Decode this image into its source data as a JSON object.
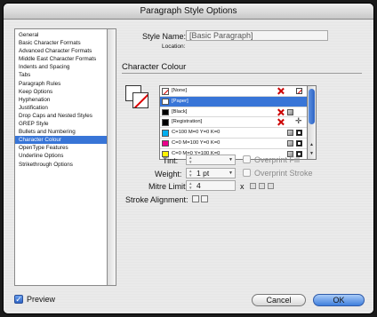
{
  "window": {
    "title": "Paragraph Style Options"
  },
  "categories": [
    "General",
    "Basic Character Formats",
    "Advanced Character Formats",
    "Middle East Character Formats",
    "Indents and Spacing",
    "Tabs",
    "Paragraph Rules",
    "Keep Options",
    "Hyphenation",
    "Justification",
    "Drop Caps and Nested Styles",
    "GREP Style",
    "Bullets and Numbering",
    "Character Colour",
    "OpenType Features",
    "Underline Options",
    "Strikethrough Options"
  ],
  "selected_category": "Character Colour",
  "style_name": {
    "label": "Style Name:",
    "value": "[Basic Paragraph]"
  },
  "location": {
    "label": "Location:"
  },
  "section_title": "Character Colour",
  "swatches": [
    {
      "name": "[None]",
      "color": "#ffffff",
      "kind": "none"
    },
    {
      "name": "[Paper]",
      "color": "#ffffff",
      "kind": "paper"
    },
    {
      "name": "[Black]",
      "color": "#000000",
      "kind": "black"
    },
    {
      "name": "[Registration]",
      "color": "#000000",
      "kind": "registration"
    },
    {
      "name": "C=100 M=0 Y=0 K=0",
      "color": "#00aeef",
      "kind": "cmyk"
    },
    {
      "name": "C=0 M=100 Y=0 K=0",
      "color": "#ec008c",
      "kind": "cmyk"
    },
    {
      "name": "C=0 M=0 Y=100 K=0",
      "color": "#fff200",
      "kind": "cmyk"
    }
  ],
  "selected_swatch": "[Paper]",
  "tint": {
    "label": "Tint:",
    "value": ""
  },
  "weight": {
    "label": "Weight:",
    "value": "1 pt"
  },
  "mitre": {
    "label": "Mitre Limit:",
    "value": "4",
    "suffix": "x"
  },
  "stroke_alignment": {
    "label": "Stroke Alignment:"
  },
  "overprint_fill": {
    "label": "Overprint Fill",
    "checked": false
  },
  "overprint_stroke": {
    "label": "Overprint Stroke",
    "checked": false
  },
  "preview": {
    "label": "Preview",
    "checked": true
  },
  "buttons": {
    "cancel": "Cancel",
    "ok": "OK"
  },
  "colors": {
    "selection": "#3875d7",
    "ok_button": "#3f7fdd"
  }
}
